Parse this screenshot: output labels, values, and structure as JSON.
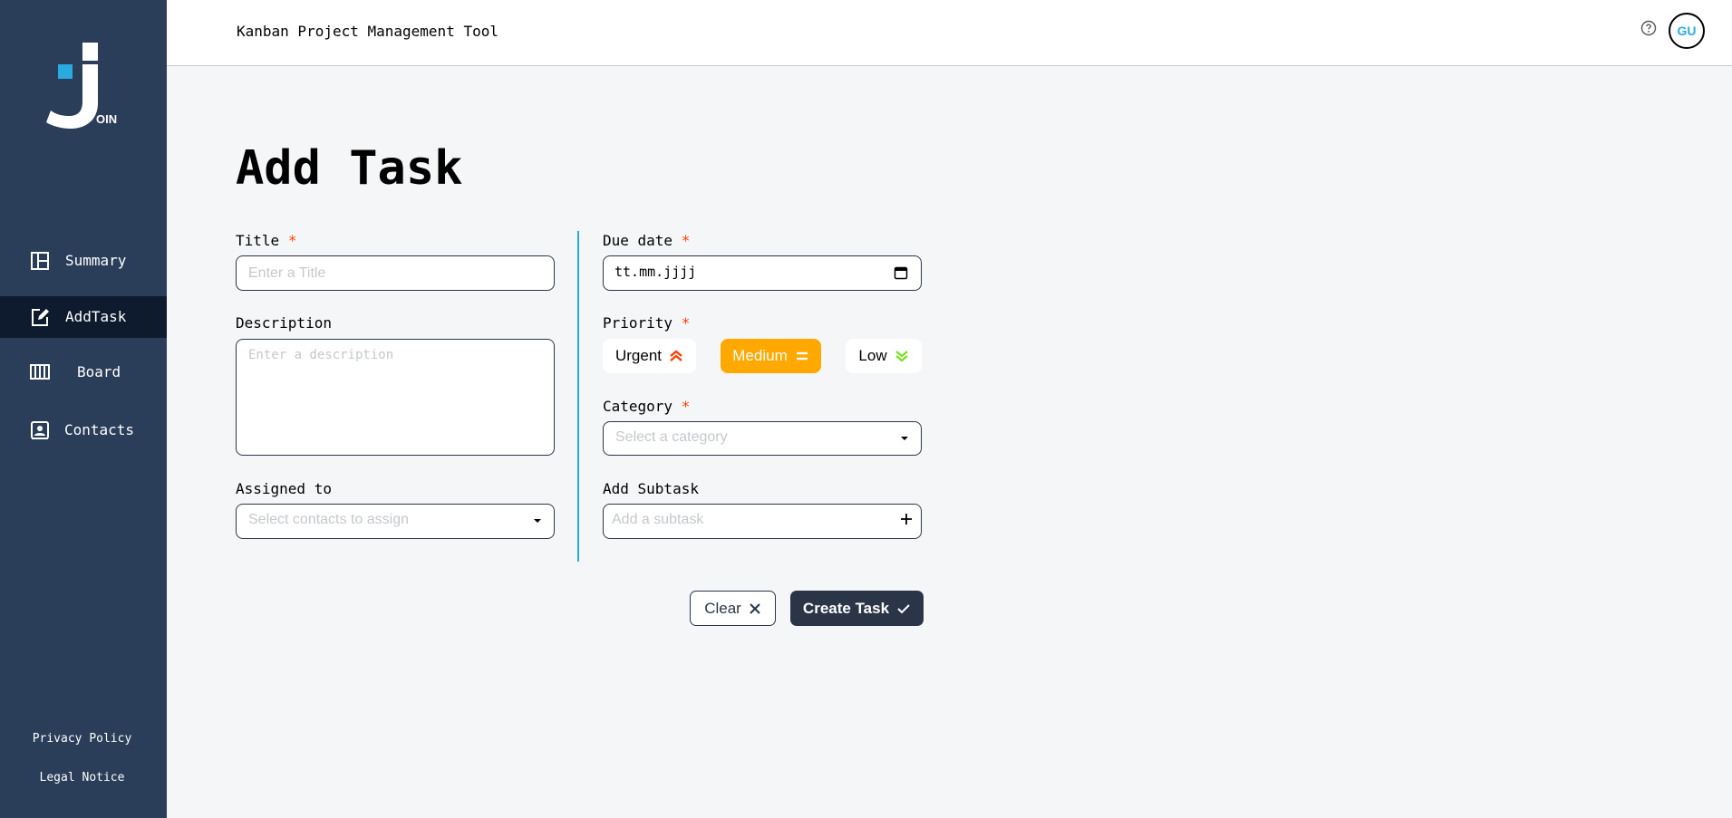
{
  "app": {
    "title": "Kanban Project Management Tool",
    "logo_suffix": "OIN"
  },
  "header": {
    "avatar_initials": "GU",
    "help_icon": "help-circle-icon"
  },
  "sidebar": {
    "items": [
      {
        "label": "Summary",
        "icon": "summary-icon",
        "active": false
      },
      {
        "label": "AddTask",
        "icon": "edit-icon",
        "active": true
      },
      {
        "label": "Board",
        "icon": "board-icon",
        "active": false
      },
      {
        "label": "Contacts",
        "icon": "contacts-icon",
        "active": false
      }
    ],
    "footer": {
      "privacy": "Privacy Policy",
      "legal": "Legal Notice"
    }
  },
  "page": {
    "title": "Add Task"
  },
  "form": {
    "title": {
      "label": "Title",
      "required_mark": "*",
      "placeholder": "Enter a Title",
      "value": ""
    },
    "description": {
      "label": "Description",
      "placeholder": "Enter a description",
      "value": ""
    },
    "assigned": {
      "label": "Assigned to",
      "placeholder": "Select contacts to assign"
    },
    "due_date": {
      "label": "Due date",
      "required_mark": "*",
      "value": "tt.mm.jjjj"
    },
    "priority": {
      "label": "Priority",
      "required_mark": "*",
      "options": [
        {
          "label": "Urgent",
          "icon": "double-chevron-up-icon",
          "color": "#ff3d00"
        },
        {
          "label": "Medium",
          "icon": "equals-icon",
          "color": "#ffa800"
        },
        {
          "label": "Low",
          "icon": "double-chevron-down-icon",
          "color": "#7ae229"
        }
      ],
      "selected": "Medium"
    },
    "category": {
      "label": "Category",
      "required_mark": "*",
      "placeholder": "Select a category"
    },
    "subtask": {
      "label": "Add Subtask",
      "placeholder": "Add a subtask"
    }
  },
  "buttons": {
    "clear": "Clear",
    "create": "Create Task"
  },
  "colors": {
    "sidebar": "#2a3d59",
    "accent": "#29abe2",
    "required": "#ff3d00",
    "primary": "#2a3647"
  }
}
